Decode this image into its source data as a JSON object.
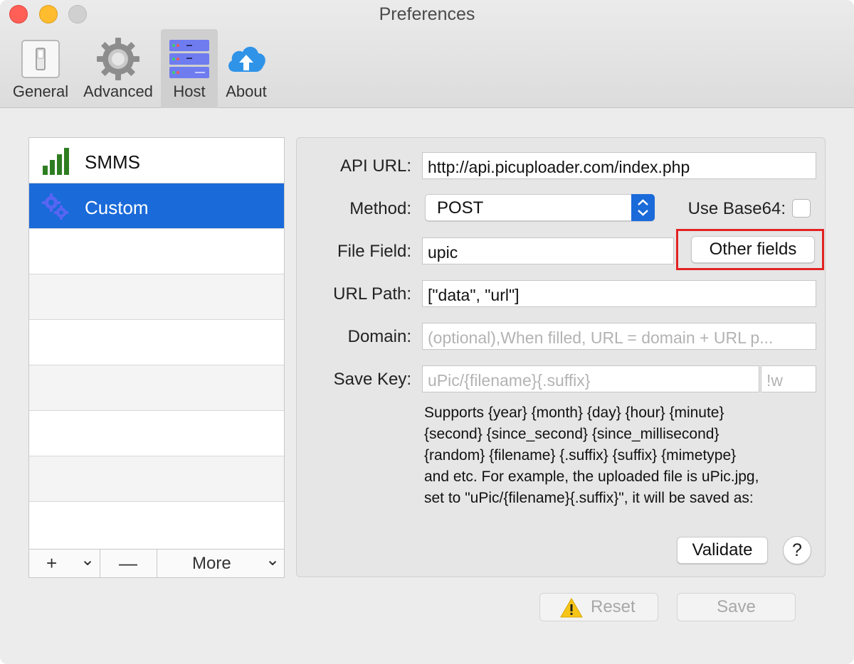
{
  "window": {
    "title": "Preferences"
  },
  "toolbar": {
    "items": [
      {
        "label": "General",
        "icon": "switch-icon"
      },
      {
        "label": "Advanced",
        "icon": "gear-icon"
      },
      {
        "label": "Host",
        "icon": "server-icon",
        "selected": true
      },
      {
        "label": "About",
        "icon": "cloud-upload-icon"
      }
    ]
  },
  "hosts": {
    "items": [
      {
        "label": "SMMS",
        "icon": "signal-bars-icon"
      },
      {
        "label": "Custom",
        "icon": "gears-icon",
        "selected": true
      }
    ],
    "buttons": {
      "add": "+",
      "add_menu": "⌄",
      "remove": "—",
      "more": "More",
      "more_menu": "⌄"
    }
  },
  "form": {
    "api_url": {
      "label": "API URL:",
      "value": "http://api.picuploader.com/index.php"
    },
    "method": {
      "label": "Method:",
      "value": "POST"
    },
    "base64": {
      "label": "Use Base64:",
      "checked": false
    },
    "file_field": {
      "label": "File Field:",
      "value": "upic"
    },
    "other_fields_button": "Other fields",
    "url_path": {
      "label": "URL Path:",
      "value": "[\"data\", \"url\"]"
    },
    "domain": {
      "label": "Domain:",
      "placeholder": "(optional),When filled, URL = domain + URL p..."
    },
    "save_key": {
      "label": "Save Key:",
      "placeholder": "uPic/{filename}{.suffix}",
      "suffix_placeholder": "!w"
    },
    "help_lines": [
      "Supports {year} {month} {day} {hour} {minute}",
      "{second} {since_second} {since_millisecond}",
      "{random} {filename} {.suffix} {suffix} {mimetype}",
      "and etc. For example, the uploaded file is uPic.jpg,",
      "set to \"uPic/{filename}{.suffix}\", it will be saved as:"
    ],
    "validate_button": "Validate",
    "help_button": "?"
  },
  "footer": {
    "reset": "Reset",
    "save": "Save"
  },
  "colors": {
    "accent": "#1a6ad9",
    "highlight": "#e32323",
    "warning": "#f5c518"
  }
}
